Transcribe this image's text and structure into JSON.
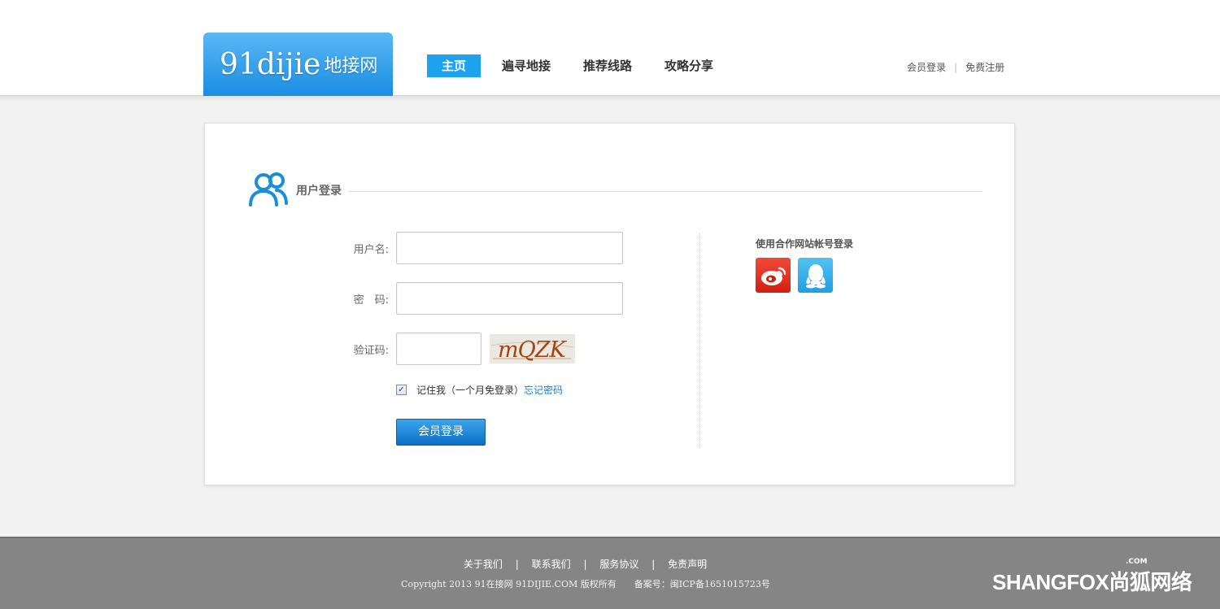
{
  "header": {
    "logo_en": "91dijie",
    "logo_cn": "地接网",
    "nav": [
      "主页",
      "遍寻地接",
      "推荐线路",
      "攻略分享"
    ],
    "member_login": "会员登录",
    "register": "免费注册",
    "separator": "|"
  },
  "login": {
    "section_title": "用户登录",
    "username_label": "用户名:",
    "password_label": "密　码:",
    "captcha_label": "验证码:",
    "captcha_text": "mQZK",
    "remember_text": "记住我（一个月免登录）",
    "forgot_text": "忘记密码",
    "submit_label": "会员登录"
  },
  "partner": {
    "title": "使用合作网站帐号登录",
    "providers": [
      "weibo-icon",
      "qq-icon"
    ]
  },
  "footer": {
    "links": [
      "关于我们",
      "联系我们",
      "服务协议",
      "免责声明"
    ],
    "separator": "|",
    "copyright": "Copyright 2013 91在接网 91DIJIE.COM 版权所有　　备案号：闽ICP备1651015723号",
    "brand_com": ".COM",
    "brand_name": "SHANGFOX尚狐网络"
  },
  "colors": {
    "accent": "#1da2ef",
    "button": "#0c6fc4",
    "link": "#1a7fc9",
    "footer_bg": "#858585"
  }
}
